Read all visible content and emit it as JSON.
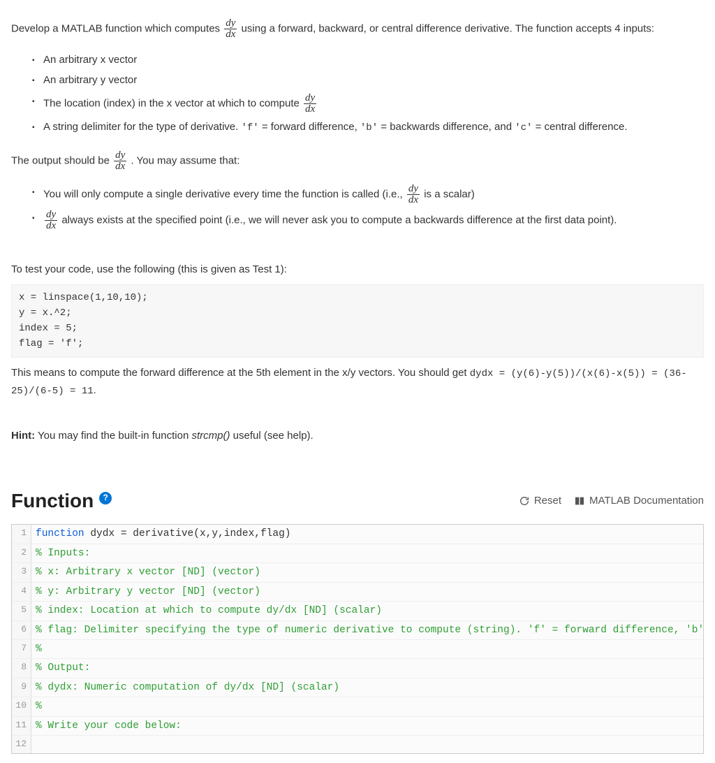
{
  "intro": {
    "p1_a": "Develop a MATLAB function which computes ",
    "p1_b": " using a forward, backward, or central difference derivative. The function accepts 4 inputs:"
  },
  "dy": "dy",
  "dx": "dx",
  "inputs_list": {
    "i1": "An arbitrary x vector",
    "i2": "An arbitrary y vector",
    "i3_a": "The location (index) in the x vector at which to compute ",
    "i4_a": "A string delimiter for the type of derivative. ",
    "i4_f": "'f'",
    "i4_b1": " = forward difference, ",
    "i4_bq": "'b'",
    "i4_b2": " = backwards difference, and ",
    "i4_cq": "'c'",
    "i4_b3": " = central difference."
  },
  "output_line": {
    "a": "The output should be ",
    "b": ". You may assume that:"
  },
  "assumptions": {
    "a1_a": "You will only compute a single derivative every time the function is called (i.e., ",
    "a1_b": " is a scalar)",
    "a2_b": " always exists at the specified point (i.e., we will never ask you to compute a backwards difference at the first data point)."
  },
  "test_intro": "To test your code, use the following (this is given as Test 1):",
  "test_code": "x = linspace(1,10,10);\ny = x.^2;\nindex = 5;\nflag = 'f';",
  "test_expl_a": "This means to compute the forward difference at the 5th element in the x/y vectors. You should get ",
  "test_expl_code": "dydx = (y(6)-y(5))/(x(6)-x(5)) = (36-25)/(6-5) = 11",
  "test_expl_b": ".",
  "hint_label": "Hint:",
  "hint_a": " You may find the built-in function ",
  "hint_fn": "strcmp()",
  "hint_b": " useful (see help).",
  "section": {
    "title": "Function",
    "help": "?",
    "reset": "Reset",
    "doc": "MATLAB Documentation"
  },
  "editor": [
    {
      "n": "1",
      "kw": "function",
      "rest": " dydx = derivative(x,y,index,flag)"
    },
    {
      "n": "2",
      "cm": "% Inputs:"
    },
    {
      "n": "3",
      "cm": "% x: Arbitrary x vector [ND] (vector)"
    },
    {
      "n": "4",
      "cm": "% y: Arbitrary y vector [ND] (vector)"
    },
    {
      "n": "5",
      "cm": "% index: Location at which to compute dy/dx [ND] (scalar)"
    },
    {
      "n": "6",
      "cm": "% flag: Delimiter specifying the type of numeric derivative to compute (string). 'f' = forward difference, 'b' = backwards"
    },
    {
      "n": "7",
      "cm": "%"
    },
    {
      "n": "8",
      "cm": "% Output:"
    },
    {
      "n": "9",
      "cm": "% dydx: Numeric computation of dy/dx [ND] (scalar)"
    },
    {
      "n": "10",
      "cm": "%"
    },
    {
      "n": "11",
      "cm": "% Write your code below:"
    },
    {
      "n": "12",
      "plain": ""
    }
  ]
}
